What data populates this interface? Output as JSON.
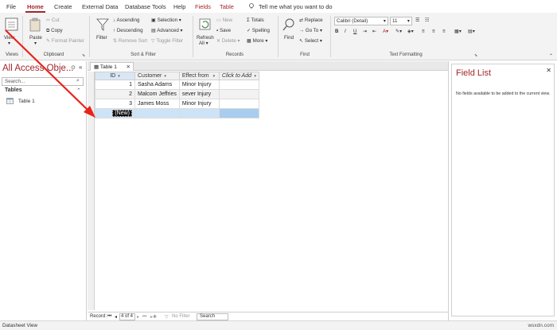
{
  "menu": {
    "file": "File",
    "home": "Home",
    "create": "Create",
    "external_data": "External Data",
    "database_tools": "Database Tools",
    "help": "Help",
    "fields": "Fields",
    "table": "Table",
    "tell_me": "Tell me what you want to do"
  },
  "ribbon": {
    "views": {
      "view": "View",
      "label": "Views"
    },
    "clipboard": {
      "paste": "Paste",
      "cut": "Cut",
      "copy": "Copy",
      "format_painter": "Format Painter",
      "label": "Clipboard"
    },
    "sort_filter": {
      "filter": "Filter",
      "ascending": "Ascending",
      "descending": "Descending",
      "remove_sort": "Remove Sort",
      "selection": "Selection",
      "advanced": "Advanced",
      "toggle_filter": "Toggle Filter",
      "label": "Sort & Filter"
    },
    "records": {
      "refresh": "Refresh",
      "all": "All",
      "new": "New",
      "save": "Save",
      "delete": "Delete",
      "totals": "Totals",
      "spelling": "Spelling",
      "more": "More",
      "label": "Records"
    },
    "find": {
      "find": "Find",
      "replace": "Replace",
      "go_to": "Go To",
      "select": "Select",
      "label": "Find"
    },
    "text_formatting": {
      "font": "Calibri (Detail)",
      "size": "11",
      "label": "Text Formatting"
    }
  },
  "nav": {
    "title": "All Access Obje...",
    "search_placeholder": "Search...",
    "section": "Tables",
    "tables": [
      "Table 1"
    ]
  },
  "document": {
    "tab": "Table 1",
    "columns": [
      "ID",
      "Customer",
      "Effect from ",
      "Click to Add"
    ],
    "rows": [
      {
        "id": "1",
        "customer": "Sasha Adams",
        "effect": "Minor Injury"
      },
      {
        "id": "2",
        "customer": "Malcom Jeffries",
        "effect": "sever Injury"
      },
      {
        "id": "3",
        "customer": "James Moss",
        "effect": "Minor Injury"
      }
    ],
    "new_row": "(New)"
  },
  "record_nav": {
    "record_label": "Record:",
    "position": "4 of 4",
    "filter": "No Filter",
    "search": "Search"
  },
  "field_list": {
    "title": "Field List",
    "message": "No fields available to be added to the current view."
  },
  "status": {
    "view": "Datasheet View",
    "watermark": "wsxdn.com"
  },
  "colors": {
    "accent": "#a4262c",
    "annotation_arrow": "#e8231c",
    "new_row": "#cde3f7"
  }
}
